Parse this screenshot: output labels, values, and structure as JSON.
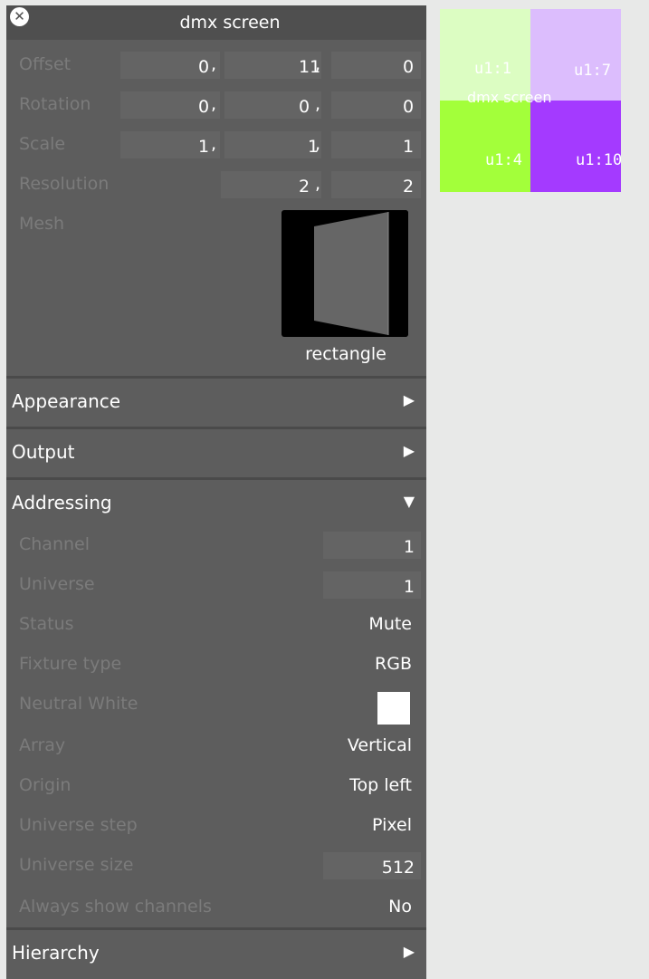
{
  "window": {
    "title": "dmx screen"
  },
  "transform": {
    "offset": {
      "label": "Offset",
      "values": [
        "0",
        "11",
        "0"
      ]
    },
    "rotation": {
      "label": "Rotation",
      "values": [
        "0",
        "0",
        "0"
      ]
    },
    "scale": {
      "label": "Scale",
      "values": [
        "1",
        "1",
        "1"
      ]
    },
    "resolution": {
      "label": "Resolution",
      "values": [
        "2",
        "2"
      ]
    },
    "separator": ","
  },
  "mesh": {
    "label": "Mesh",
    "name": "rectangle"
  },
  "sections": {
    "appearance": {
      "label": "Appearance",
      "expanded": false
    },
    "output": {
      "label": "Output",
      "expanded": false
    },
    "addressing": {
      "label": "Addressing",
      "expanded": true
    },
    "hierarchy": {
      "label": "Hierarchy",
      "expanded": false
    }
  },
  "addressing": {
    "channel": {
      "label": "Channel",
      "value": "1"
    },
    "universe": {
      "label": "Universe",
      "value": "1"
    },
    "status": {
      "label": "Status",
      "value": "Mute"
    },
    "fixture_type": {
      "label": "Fixture type",
      "value": "RGB"
    },
    "neutral_white": {
      "label": "Neutral White",
      "color": "#ffffff"
    },
    "array": {
      "label": "Array",
      "value": "Vertical"
    },
    "origin": {
      "label": "Origin",
      "value": "Top left"
    },
    "universe_step": {
      "label": "Universe step",
      "value": "Pixel"
    },
    "universe_size": {
      "label": "Universe size",
      "value": "512"
    },
    "always_show_channels": {
      "label": "Always show channels",
      "value": "No"
    }
  },
  "preview": {
    "title": "dmx screen",
    "cells": [
      {
        "label": "u1:1",
        "color": "#dcfdc2"
      },
      {
        "label": "u1:7",
        "color": "#dcbdfd"
      },
      {
        "label": "u1:4",
        "color": "#a3ff3a"
      },
      {
        "label": "u1:10",
        "color": "#a43aff"
      }
    ]
  },
  "colors": {
    "panel_bg": "#5d5d5d",
    "titlebar_bg": "#4f4f4f",
    "field_bg": "#646464",
    "label_dim": "#7b7b7b",
    "canvas_bg": "#e8e9e8"
  },
  "icons": {
    "close": "close-icon",
    "collapsed": "triangle-right-icon",
    "expanded": "triangle-down-icon"
  }
}
